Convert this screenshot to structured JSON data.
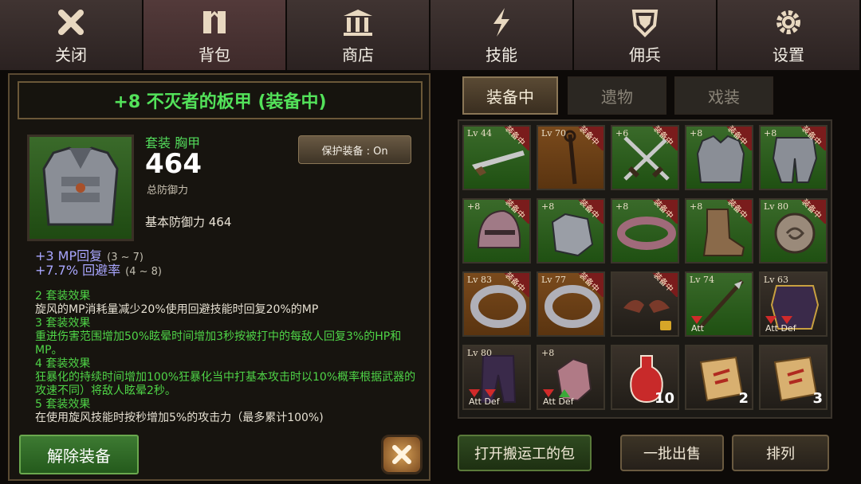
{
  "nav": {
    "tabs": [
      {
        "label": "关闭",
        "icon": "close-icon"
      },
      {
        "label": "背包",
        "icon": "backpack-icon"
      },
      {
        "label": "商店",
        "icon": "shop-icon"
      },
      {
        "label": "技能",
        "icon": "skill-lightning-icon"
      },
      {
        "label": "佣兵",
        "icon": "mercenary-shield-icon"
      },
      {
        "label": "设置",
        "icon": "gear-icon"
      }
    ],
    "active_tab": "背包"
  },
  "detail": {
    "title": "+8 不灭者的板甲 (装备中)",
    "category": "套装 胸甲",
    "defense": "464",
    "defense_label": "总防御力",
    "base_defense": "基本防御力 464",
    "protect_label": "保护装备 : On",
    "stat1": "+3 MP回复",
    "stat1_range": "(3 ~ 7)",
    "stat2": "+7.7% 回避率",
    "stat2_range": "(4 ~ 8)",
    "set_effects": [
      {
        "head": "2 套装效果",
        "body": "旋风的MP消耗量减少20%使用回避技能时回复20%的MP"
      },
      {
        "head": "3 套装效果",
        "body": "重进伤害范围增加50%眩晕时间增加3秒按被打中的每敌人回复3%的HP和MP。"
      },
      {
        "head": "4 套装效果",
        "body": "狂暴化的持续时间增加100%狂暴化当中打基本攻击时以10%概率根据武器的攻速不同）将敌人眩晕2秒。"
      },
      {
        "head": "5 套装效果",
        "body": "在使用旋风技能时按秒增加5%的攻击力（最多累计100%)"
      }
    ],
    "unequip_label": "解除装备"
  },
  "inventory": {
    "tabs": [
      "装备中",
      "遗物",
      "戏装"
    ],
    "active_tab": "装备中",
    "equipped_badge": "装备中",
    "items": [
      {
        "lv": "Lv 44",
        "bg": "green",
        "equipped": true,
        "icon": "rifle-icon"
      },
      {
        "lv": "Lv 70",
        "bg": "orange",
        "equipped": true,
        "icon": "staff-icon"
      },
      {
        "lv": "+6",
        "bg": "green",
        "equipped": true,
        "icon": "crossed-swords-icon"
      },
      {
        "lv": "+8",
        "bg": "green",
        "equipped": true,
        "icon": "plate-armor-icon"
      },
      {
        "lv": "+8",
        "bg": "green",
        "equipped": true,
        "icon": "leg-armor-icon"
      },
      {
        "lv": "+8",
        "bg": "green",
        "equipped": true,
        "icon": "helmet-icon"
      },
      {
        "lv": "+8",
        "bg": "green",
        "equipped": true,
        "icon": "gauntlet-icon"
      },
      {
        "lv": "+8",
        "bg": "green",
        "equipped": true,
        "icon": "belt-icon"
      },
      {
        "lv": "+8",
        "bg": "green",
        "equipped": true,
        "icon": "boots-icon"
      },
      {
        "lv": "Lv 80",
        "bg": "green",
        "equipped": true,
        "icon": "amulet-icon"
      },
      {
        "lv": "Lv 83",
        "bg": "orange",
        "equipped": true,
        "icon": "ring-icon"
      },
      {
        "lv": "Lv 77",
        "bg": "orange",
        "equipped": true,
        "icon": "ring-icon"
      },
      {
        "lv": "",
        "bg": "dark",
        "equipped": true,
        "icon": "wings-icon",
        "locked": true
      },
      {
        "lv": "Lv 74",
        "bg": "green",
        "equipped": false,
        "icon": "spear-icon",
        "att": "Att"
      },
      {
        "lv": "Lv 63",
        "bg": "dark",
        "equipped": false,
        "icon": "chest-armor-icon",
        "att": "Att  Def"
      },
      {
        "lv": "Lv 80",
        "bg": "dark",
        "equipped": false,
        "icon": "pants-icon",
        "att": "Att  Def"
      },
      {
        "lv": "+8",
        "bg": "dark",
        "equipped": false,
        "icon": "glove-icon",
        "att": "Att  Def"
      },
      {
        "lv": "",
        "bg": "dark",
        "equipped": false,
        "icon": "red-potion-icon",
        "count": "10"
      },
      {
        "lv": "",
        "bg": "dark",
        "equipped": false,
        "icon": "scroll-icon",
        "count": "2"
      },
      {
        "lv": "",
        "bg": "dark",
        "equipped": false,
        "icon": "scroll-icon",
        "count": "3"
      }
    ]
  },
  "buttons": {
    "porter_bag": "打开搬运工的包",
    "bulk_sell": "一批出售",
    "sort": "排列"
  },
  "colors": {
    "set_green": "#4fd447",
    "stat_purple": "#a9a6ff",
    "equipped_red": "#7a1c1c"
  }
}
